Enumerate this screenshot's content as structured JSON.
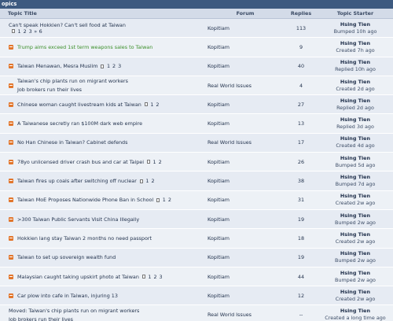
{
  "section_title": "opics",
  "columns": {
    "topic": "Topic Title",
    "forum": "Forum",
    "replies": "Replies",
    "starter": "Topic Starter"
  },
  "topics": [
    {
      "title": "Can't speak Hokkien? Can't sell food at Taiwan",
      "icon": "none",
      "pages": [
        "1",
        "2",
        "3",
        "»",
        "6"
      ],
      "forum": "Kopitiam",
      "replies": "113",
      "starter": "Hsing Tien",
      "status": "Bumped 10h ago"
    },
    {
      "title": "Trump aims exceed 1st term weapons sales to Taiwan",
      "icon": "topic-icon",
      "hot": true,
      "pages": [],
      "forum": "Kopitiam",
      "replies": "9",
      "starter": "Hsing Tien",
      "status": "Created 7h ago"
    },
    {
      "title": "Taiwan Menawan, Mesra Muslim",
      "icon": "topic-icon",
      "pages": [
        "1",
        "2",
        "3"
      ],
      "forum": "Kopitiam",
      "replies": "40",
      "starter": "Hsing Tien",
      "status": "Replied 10h ago"
    },
    {
      "title": "Taiwan's chip plants run on migrant workers",
      "subtitle": "Job brokers run their lives",
      "icon": "topic-icon",
      "pages": [],
      "forum": "Real World Issues",
      "replies": "4",
      "starter": "Hsing Tien",
      "status": "Created 2d ago"
    },
    {
      "title": "Chinese woman caught livestream kids at Taiwan",
      "icon": "topic-icon",
      "pages": [
        "1",
        "2"
      ],
      "forum": "Kopitiam",
      "replies": "27",
      "starter": "Hsing Tien",
      "status": "Replied 2d ago"
    },
    {
      "title": "A Taiwanese secretly ran $100M dark web empire",
      "icon": "topic-icon",
      "pages": [],
      "forum": "Kopitiam",
      "replies": "13",
      "starter": "Hsing Tien",
      "status": "Replied 3d ago"
    },
    {
      "title": "No Han Chinese in Taiwan? Cabinet defends",
      "icon": "topic-icon",
      "pages": [],
      "forum": "Real World Issues",
      "replies": "17",
      "starter": "Hsing Tien",
      "status": "Created 4d ago"
    },
    {
      "title": "78yo unlicensed driver crash bus and car at Taipei",
      "icon": "topic-icon",
      "pages": [
        "1",
        "2"
      ],
      "forum": "Kopitiam",
      "replies": "26",
      "starter": "Hsing Tien",
      "status": "Bumped 5d ago"
    },
    {
      "title": "Taiwan fires up coals after switching off nuclear",
      "icon": "topic-icon",
      "pages": [
        "1",
        "2"
      ],
      "forum": "Kopitiam",
      "replies": "38",
      "starter": "Hsing Tien",
      "status": "Bumped 7d ago"
    },
    {
      "title": "Taiwan MoE Proposes Nationwide Phone Ban in School",
      "icon": "topic-icon",
      "pages": [
        "1",
        "2"
      ],
      "forum": "Kopitiam",
      "replies": "31",
      "starter": "Hsing Tien",
      "status": "Created 2w ago"
    },
    {
      "title": ">300 Taiwan Public Servants Visit China Illegally",
      "icon": "topic-icon",
      "pages": [],
      "forum": "Kopitiam",
      "replies": "19",
      "starter": "Hsing Tien",
      "status": "Bumped 2w ago"
    },
    {
      "title": "Hokkien lang stay Taiwan 2 months no need passport",
      "icon": "topic-icon",
      "pages": [],
      "forum": "Kopitiam",
      "replies": "18",
      "starter": "Hsing Tien",
      "status": "Created 2w ago"
    },
    {
      "title": "Taiwan to set up sovereign wealth fund",
      "icon": "topic-icon",
      "pages": [],
      "forum": "Kopitiam",
      "replies": "19",
      "starter": "Hsing Tien",
      "status": "Bumped 2w ago"
    },
    {
      "title": "Malaysian caught taking upskirt photo at Taiwan",
      "icon": "topic-icon",
      "pages": [
        "1",
        "2",
        "3"
      ],
      "forum": "Kopitiam",
      "replies": "44",
      "starter": "Hsing Tien",
      "status": "Bumped 2w ago"
    },
    {
      "title": "Car plow into cafe in Taiwan, injuring 13",
      "icon": "topic-icon",
      "pages": [],
      "forum": "Kopitiam",
      "replies": "12",
      "starter": "Hsing Tien",
      "status": "Created 2w ago"
    },
    {
      "title": "Moved: Taiwan's chip plants run on migrant workers",
      "subtitle": "Job brokers run their lives",
      "icon": "none",
      "moved": true,
      "pages": [],
      "forum": "Real World Issues",
      "replies": "--",
      "starter": "Hsing Tien",
      "status": "Created a long time ago"
    }
  ]
}
